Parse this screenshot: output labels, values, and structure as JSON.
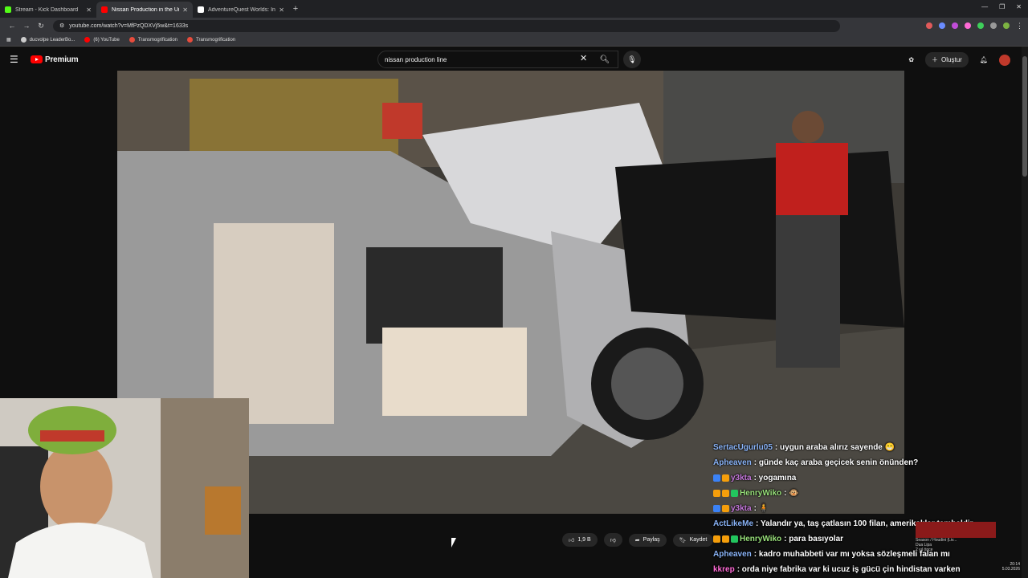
{
  "browser": {
    "tabs": [
      {
        "title": "Stream - Kick Dashboard",
        "fav_color": "#53fc18",
        "active": false
      },
      {
        "title": "Nissan Production in the Unite",
        "fav_color": "#ff0000",
        "active": true
      },
      {
        "title": "AdventureQuest Worlds: Infinit",
        "fav_color": "#ffffff",
        "active": false
      }
    ],
    "new_tab": "+",
    "url": "youtube.com/watch?v=MfPzQDXVj5w&t=1633s",
    "bookmarks": [
      {
        "label": "ducvolpe LeaderBo...",
        "color": "#cccccc"
      },
      {
        "label": "(6) YouTube",
        "color": "#ff0000"
      },
      {
        "label": "Transmogrification",
        "color": "#e74c3c"
      },
      {
        "label": "Transmogrification",
        "color": "#e74c3c"
      }
    ]
  },
  "youtube": {
    "logo_text": "Premium",
    "search_value": "nissan production line",
    "create_label": "Oluştur",
    "like_count": "1,9 B",
    "share_label": "Paylaş",
    "save_label": "Kaydet"
  },
  "chat": [
    {
      "user": "SertacUgurlu05",
      "user_color": "#8ab4f8",
      "text": ": uygun araba alırız sayende 😁",
      "badges": []
    },
    {
      "user": "Apheaven",
      "user_color": "#8ab4f8",
      "text": ": günde kaç araba geçicek senin önünden?",
      "badges": []
    },
    {
      "user": "y3kta",
      "user_color": "#c678dd",
      "text": ": yogamına",
      "badges": [
        "#3b82f6",
        "#f59e0b"
      ]
    },
    {
      "user": "HenryWiko",
      "user_color": "#98e07a",
      "text": ": 🐵",
      "badges": [
        "#f59e0b",
        "#f59e0b",
        "#22c55e"
      ]
    },
    {
      "user": "y3kta",
      "user_color": "#c678dd",
      "text": ": 🧍",
      "badges": [
        "#3b82f6",
        "#f59e0b"
      ]
    },
    {
      "user": "ActLikeMe",
      "user_color": "#8ab4f8",
      "text": ": Yalandır ya, taş çatlasın 100 filan, amerikalılar tembeldir",
      "badges": []
    },
    {
      "user": "HenryWiko",
      "user_color": "#98e07a",
      "text": ": para basıyolar",
      "badges": [
        "#f59e0b",
        "#f59e0b",
        "#22c55e"
      ]
    },
    {
      "user": "Apheaven",
      "user_color": "#8ab4f8",
      "text": ": kadro muhabbeti var mı yoksa sözleşmeli falan mı",
      "badges": []
    },
    {
      "user": "kkrep",
      "user_color": "#ff6ad5",
      "text": ": orda niye fabrika var ki ucuz iş gücü çin hindistan varken",
      "badges": []
    }
  ],
  "miniplayer": {
    "title": "Season / Houdini (Liv...",
    "channel": "Dua Lipa",
    "meta": "2 yıl önce"
  },
  "clock": {
    "time": "20:14",
    "date": "5.03.2026"
  }
}
